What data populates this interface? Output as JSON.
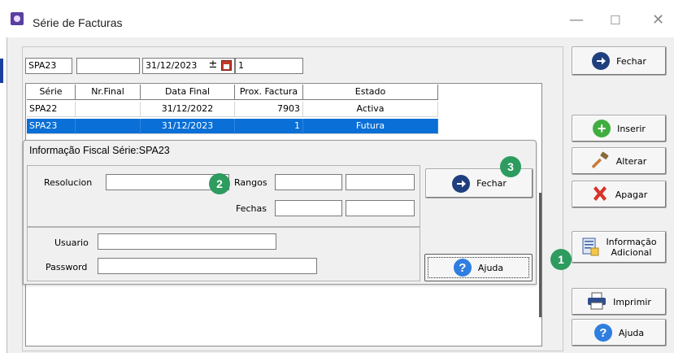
{
  "window": {
    "title": "Série de Facturas"
  },
  "toolbar": {
    "serie": "SPA23",
    "nr_final": "",
    "data_final": "31/12/2023",
    "prox_factura": "1"
  },
  "grid": {
    "columns": [
      "Série",
      "Nr.Final",
      "Data Final",
      "Prox. Factura",
      "Estado"
    ],
    "rows": [
      {
        "serie": "SPA22",
        "nr_final": "",
        "data_final": "31/12/2022",
        "prox": "7903",
        "estado": "Activa"
      },
      {
        "serie": "SPA23",
        "nr_final": "",
        "data_final": "31/12/2023",
        "prox": "1",
        "estado": "Futura"
      }
    ]
  },
  "dialog": {
    "title": "Informação Fiscal Série:SPA23",
    "resolucion_label": "Resolucion",
    "rangos_label": "Rangos",
    "fechas_label": "Fechas",
    "usuario_label": "Usuario",
    "password_label": "Password",
    "fechar_label": "Fechar",
    "ajuda_label": "Ajuda"
  },
  "side_buttons": {
    "fechar": "Fechar",
    "inserir": "Inserir",
    "alterar": "Alterar",
    "apagar": "Apagar",
    "info_line1": "Informação",
    "info_line2": "Adicional",
    "imprimir": "Imprimir",
    "ajuda": "Ajuda"
  },
  "callouts": [
    "1",
    "2",
    "3"
  ],
  "colors": {
    "selection": "#0a6fd6",
    "callout": "#2e9b5f",
    "arrow_icon": "#1f3f7f",
    "help_icon": "#2f7ee0"
  }
}
